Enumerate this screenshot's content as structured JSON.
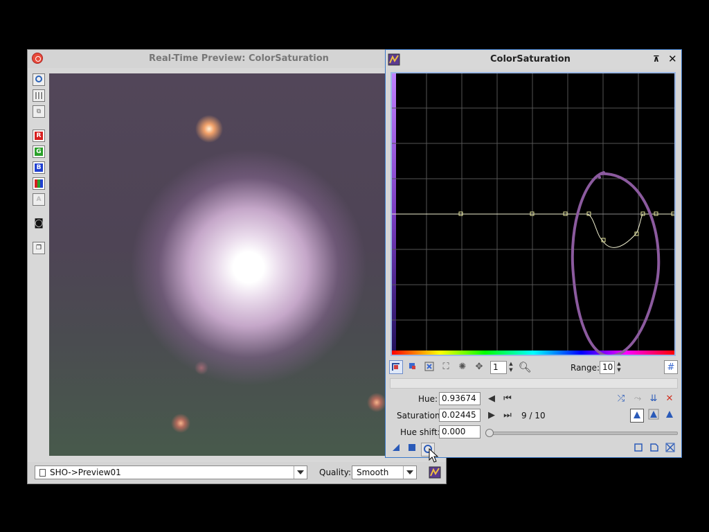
{
  "preview_window": {
    "title": "Real-Time Preview: ColorSaturation",
    "sidebar_buttons": [
      {
        "name": "mode-circle-icon",
        "glyph": "○"
      },
      {
        "name": "split-view-icon",
        "glyph": "▦"
      },
      {
        "name": "overlay-view-icon",
        "glyph": "⧉"
      },
      {
        "name": "channel-r-icon",
        "glyph": "R",
        "color": "#d62020"
      },
      {
        "name": "channel-g-icon",
        "glyph": "G",
        "color": "#2aa02a"
      },
      {
        "name": "channel-b-icon",
        "glyph": "B",
        "color": "#2040d0"
      },
      {
        "name": "channel-rgb-icon",
        "glyph": "▮▮",
        "color": "#333333"
      },
      {
        "name": "channel-a-icon",
        "glyph": "A",
        "color": "#aaaaaa"
      },
      {
        "name": "camera-icon",
        "glyph": "◙"
      },
      {
        "name": "window-icon",
        "glyph": "❐"
      }
    ],
    "view_selector": "SHO->Preview01",
    "quality_label": "Quality:",
    "quality_value": "Smooth"
  },
  "colorsat_window": {
    "title": "ColorSaturation",
    "toolbar": {
      "zoom_value": "1",
      "range_label": "Range:",
      "range_value": "10"
    },
    "hue_label": "Hue:",
    "hue_value": "0.93674",
    "saturation_label": "Saturation:",
    "saturation_value": "0.02445",
    "point_counter": "9 / 10",
    "hue_shift_label": "Hue shift:",
    "hue_shift_value": "0.000"
  },
  "colors": {
    "accent": "#3a78c8",
    "annotation": "#8b5a9e",
    "curve": "#f0f0d0"
  }
}
